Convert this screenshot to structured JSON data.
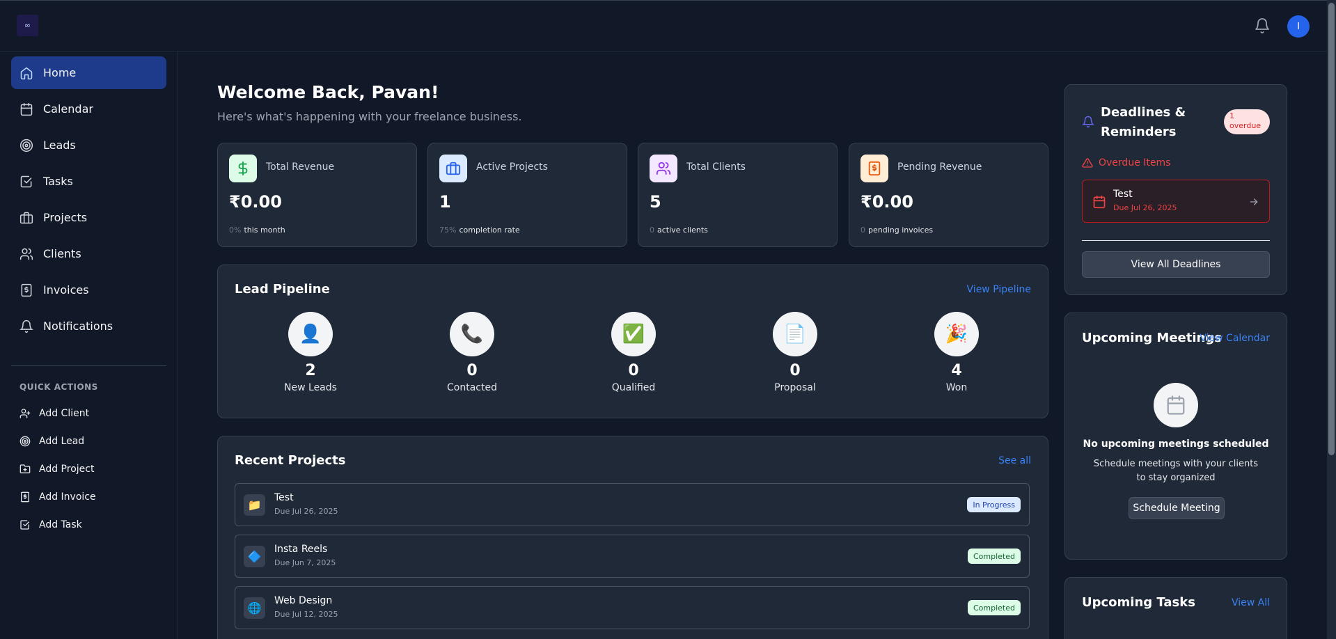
{
  "header": {
    "logo_glyph": "∞",
    "avatar_initial": "I"
  },
  "sidebar": {
    "items": [
      {
        "label": "Home",
        "icon": "home-icon"
      },
      {
        "label": "Calendar",
        "icon": "calendar-icon"
      },
      {
        "label": "Leads",
        "icon": "target-icon"
      },
      {
        "label": "Tasks",
        "icon": "checkbox-icon"
      },
      {
        "label": "Projects",
        "icon": "briefcase-icon"
      },
      {
        "label": "Clients",
        "icon": "users-icon"
      },
      {
        "label": "Invoices",
        "icon": "invoice-icon"
      },
      {
        "label": "Notifications",
        "icon": "bell-icon"
      }
    ],
    "quick_actions_title": "QUICK ACTIONS",
    "quick_actions": [
      {
        "label": "Add Client",
        "icon": "user-plus-icon"
      },
      {
        "label": "Add Lead",
        "icon": "target-icon"
      },
      {
        "label": "Add Project",
        "icon": "folder-plus-icon"
      },
      {
        "label": "Add Invoice",
        "icon": "invoice-icon"
      },
      {
        "label": "Add Task",
        "icon": "checkbox-icon"
      }
    ]
  },
  "main": {
    "welcome": "Welcome Back, Pavan!",
    "subtitle": "Here's what's happening with your freelance business.",
    "stats": [
      {
        "label": "Total Revenue",
        "value": "₹0.00",
        "foot_value": "0%",
        "foot_text": "this month",
        "icon": "dollar-icon",
        "color": "#16a34a",
        "bg": "#dcfce7"
      },
      {
        "label": "Active Projects",
        "value": "1",
        "foot_value": "75%",
        "foot_text": "completion rate",
        "icon": "briefcase-icon",
        "color": "#2563eb",
        "bg": "#dbeafe"
      },
      {
        "label": "Total Clients",
        "value": "5",
        "foot_value": "0",
        "foot_text": "active clients",
        "icon": "users-icon",
        "color": "#9333ea",
        "bg": "#f3e8ff"
      },
      {
        "label": "Pending Revenue",
        "value": "₹0.00",
        "foot_value": "0",
        "foot_text": "pending invoices",
        "icon": "invoice-icon",
        "color": "#ea580c",
        "bg": "#ffedd5"
      }
    ],
    "pipeline": {
      "title": "Lead Pipeline",
      "link": "View Pipeline",
      "stages": [
        {
          "label": "New Leads",
          "count": "2",
          "emoji": "👤"
        },
        {
          "label": "Contacted",
          "count": "0",
          "emoji": "📞"
        },
        {
          "label": "Qualified",
          "count": "0",
          "emoji": "✅"
        },
        {
          "label": "Proposal",
          "count": "0",
          "emoji": "📄"
        },
        {
          "label": "Won",
          "count": "4",
          "emoji": "🎉"
        }
      ]
    },
    "projects": {
      "title": "Recent Projects",
      "link": "See all",
      "rows": [
        {
          "name": "Test",
          "due": "Due Jul 26, 2025",
          "status": "In Progress",
          "status_type": "progress",
          "emoji": "📁"
        },
        {
          "name": "Insta Reels",
          "due": "Due Jun 7, 2025",
          "status": "Completed",
          "status_type": "done",
          "emoji": "🔷"
        },
        {
          "name": "Web Design",
          "due": "Due Jul 12, 2025",
          "status": "Completed",
          "status_type": "done",
          "emoji": "🌐"
        }
      ]
    }
  },
  "right": {
    "deadlines": {
      "title_line1": "Deadlines &",
      "title_line2": "Reminders",
      "overdue_count": "1 overdue",
      "overdue_heading": "Overdue Items",
      "item_name": "Test",
      "item_due": "Due Jul 26, 2025",
      "button": "View All Deadlines"
    },
    "meetings": {
      "title": "Upcoming Meetings",
      "link": "View Calendar",
      "empty_title": "No upcoming meetings scheduled",
      "empty_text": "Schedule meetings with your clients to stay organized",
      "button": "Schedule Meeting"
    },
    "tasks": {
      "title": "Upcoming Tasks",
      "link": "View All"
    }
  },
  "colors": {
    "background": "#111827",
    "card": "#1f2937",
    "accent": "#3b82f6",
    "active_nav": "#1e3a8a",
    "danger": "#ef4444"
  }
}
